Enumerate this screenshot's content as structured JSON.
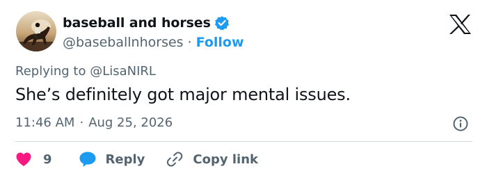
{
  "author": {
    "display_name": "baseball and horses",
    "handle": "@baseballnhorses",
    "separator": "·",
    "follow_label": "Follow",
    "avatar_icon": "horse-rider-avatar",
    "verified_icon": "verified-badge-icon"
  },
  "reply_context": {
    "prefix": "Replying to",
    "handle": "@LisaNIRL"
  },
  "tweet": {
    "text": "She’s definitely got major mental issues.",
    "time": "11:46 AM",
    "separator": "·",
    "date": "Aug 25, 2026"
  },
  "actions": {
    "like_count": "9",
    "reply_label": "Reply",
    "copy_label": "Copy link"
  },
  "colors": {
    "accent": "#1d9bf0",
    "like": "#f91880",
    "secondary_text": "#536471",
    "primary_text": "#0f1419",
    "divider": "#cfd9de"
  }
}
